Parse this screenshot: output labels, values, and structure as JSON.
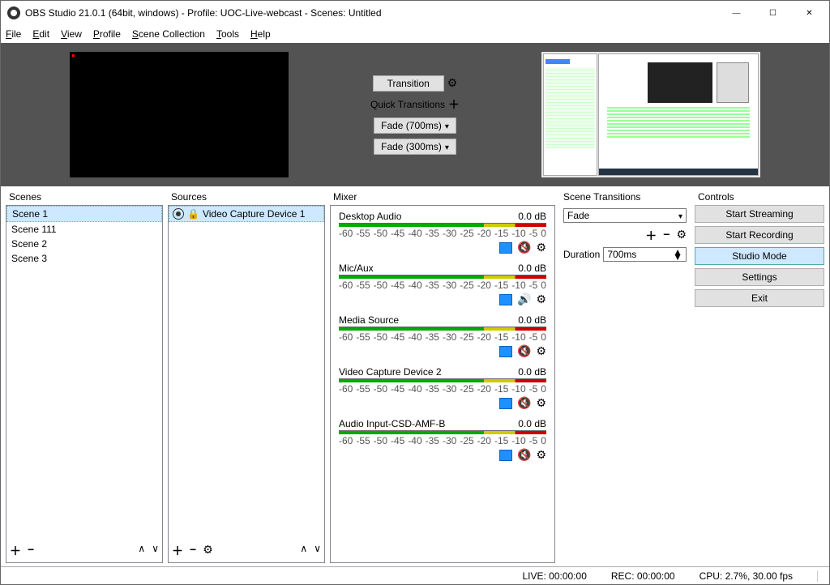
{
  "title": "OBS Studio 21.0.1 (64bit, windows) - Profile: UOC-Live-webcast - Scenes: Untitled",
  "menu": {
    "file": "File",
    "edit": "Edit",
    "view": "View",
    "profile": "Profile",
    "scene_collection": "Scene Collection",
    "tools": "Tools",
    "help": "Help"
  },
  "center": {
    "transition_btn": "Transition",
    "quick_label": "Quick Transitions",
    "fade1": "Fade (700ms)",
    "fade2": "Fade (300ms)"
  },
  "panels": {
    "scenes": "Scenes",
    "sources": "Sources",
    "mixer": "Mixer",
    "transitions": "Scene Transitions",
    "controls": "Controls"
  },
  "scenes": {
    "items": [
      {
        "label": "Scene 1"
      },
      {
        "label": "Scene 111"
      },
      {
        "label": "Scene 2"
      },
      {
        "label": "Scene 3"
      }
    ]
  },
  "sources": {
    "items": [
      {
        "label": "Video Capture Device 1"
      }
    ]
  },
  "mixer": {
    "ticks": [
      "-60",
      "-55",
      "-50",
      "-45",
      "-40",
      "-35",
      "-30",
      "-25",
      "-20",
      "-15",
      "-10",
      "-5",
      "0"
    ],
    "items": [
      {
        "name": "Desktop Audio",
        "db": "0.0 dB",
        "muted": true
      },
      {
        "name": "Mic/Aux",
        "db": "0.0 dB",
        "muted": false
      },
      {
        "name": "Media Source",
        "db": "0.0 dB",
        "muted": true
      },
      {
        "name": "Video Capture Device 2",
        "db": "0.0 dB",
        "muted": true
      },
      {
        "name": "Audio Input-CSD-AMF-B",
        "db": "0.0 dB",
        "muted": true
      }
    ]
  },
  "transitions": {
    "selected": "Fade",
    "duration_label": "Duration",
    "duration_value": "700ms"
  },
  "controls": {
    "start_streaming": "Start Streaming",
    "start_recording": "Start Recording",
    "studio_mode": "Studio Mode",
    "settings": "Settings",
    "exit": "Exit"
  },
  "status": {
    "live": "LIVE: 00:00:00",
    "rec": "REC: 00:00:00",
    "cpu": "CPU: 2.7%, 30.00 fps"
  }
}
